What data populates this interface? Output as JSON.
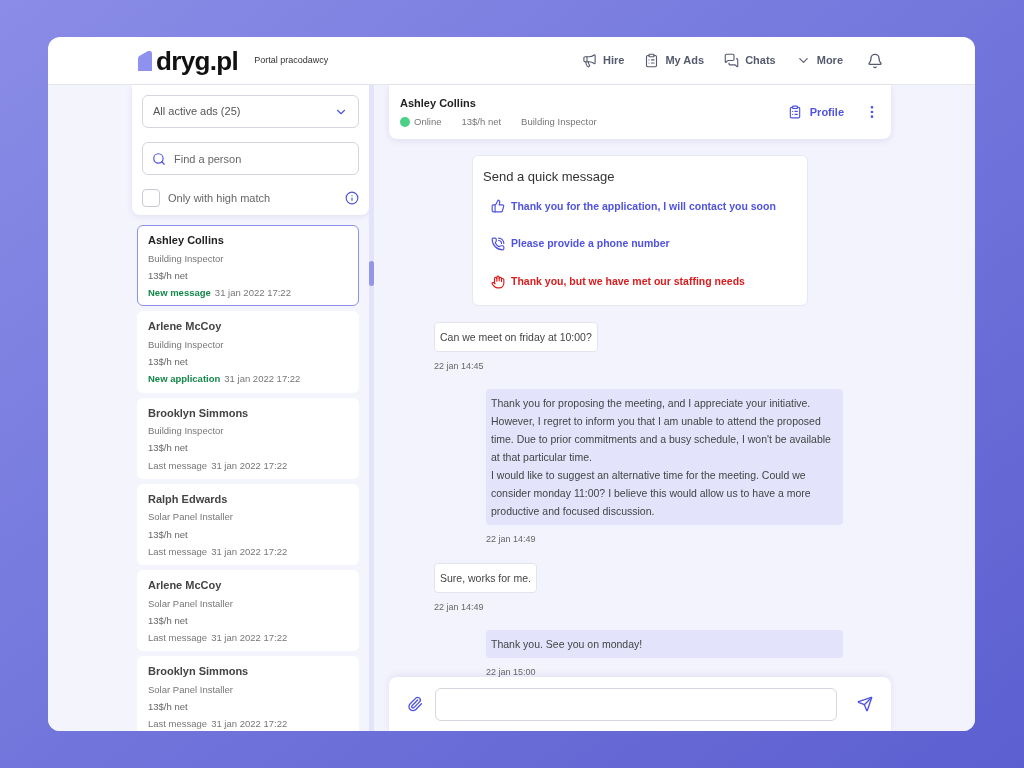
{
  "brand": {
    "logo": "dryg.pl",
    "subtitle": "Portal pracodawcy"
  },
  "nav": [
    {
      "kind": "hire",
      "label": "Hire"
    },
    {
      "kind": "ads",
      "label": "My Ads"
    },
    {
      "kind": "chats",
      "label": "Chats"
    },
    {
      "kind": "more",
      "label": "More"
    }
  ],
  "filters": {
    "ads_select": "All active ads (25)",
    "search": {
      "placeholder": "Find a person"
    },
    "high_match": {
      "label": "Only with high match",
      "checked": false
    }
  },
  "contacts": [
    {
      "name": "Ashley Collins",
      "role": "Building Inspector",
      "rate": "13$/h net",
      "status": "New message",
      "highlight": true,
      "time": "31 jan 2022 17:22",
      "selected": true
    },
    {
      "name": "Arlene McCoy",
      "role": "Building Inspector",
      "rate": "13$/h net",
      "status": "New application",
      "highlight": true,
      "time": "31 jan 2022 17:22",
      "selected": false
    },
    {
      "name": "Brooklyn Simmons",
      "role": "Building Inspector",
      "rate": "13$/h net",
      "status": "Last message",
      "highlight": false,
      "time": "31 jan 2022 17:22",
      "selected": false
    },
    {
      "name": "Ralph Edwards",
      "role": "Solar Panel Installer",
      "rate": "13$/h net",
      "status": "Last message",
      "highlight": false,
      "time": "31 jan 2022 17:22",
      "selected": false
    },
    {
      "name": "Arlene McCoy",
      "role": "Solar Panel Installer",
      "rate": "13$/h net",
      "status": "Last message",
      "highlight": false,
      "time": "31 jan 2022 17:22",
      "selected": false
    },
    {
      "name": "Brooklyn Simmons",
      "role": "Solar Panel Installer",
      "rate": "13$/h net",
      "status": "Last message",
      "highlight": false,
      "time": "31 jan 2022 17:22",
      "selected": false
    }
  ],
  "chat_header": {
    "name": "Ashley Collins",
    "online": true,
    "status": "Online",
    "rate": "13$/h net",
    "role": "Building Inspector",
    "profile": "Profile"
  },
  "quick_messages": {
    "title": "Send a quick message",
    "items": [
      {
        "kind": "thumbs",
        "text": "Thank you for the application, I will contact you soon",
        "color": "#4f53e0"
      },
      {
        "kind": "phone",
        "text": "Please provide a phone number",
        "color": "#4f53e0"
      },
      {
        "kind": "hand",
        "text": "Thank you, but we have met our staffing needs",
        "color": "#dc1c1c"
      }
    ]
  },
  "messages": [
    {
      "kind": "received",
      "text": "Can we meet on friday at 10:00?",
      "time": "22 jan 14:45"
    },
    {
      "kind": "sent",
      "text": "Thank you for proposing the meeting, and I appreciate your initiative. However, I regret to inform you that I am unable to attend the proposed time. Due to prior commitments and a busy schedule, I won't be available at that particular time.\nI would like to suggest an alternative time for the meeting. Could we consider monday 11:00? I believe this would allow us to have a more productive and focused discussion.",
      "time": "22 jan 14:49"
    },
    {
      "kind": "received",
      "text": "Sure, works for me.",
      "time": "22 jan 14:49"
    },
    {
      "kind": "sent",
      "text": "Thank you. See you on monday!",
      "time": "22 jan 15:00"
    }
  ]
}
